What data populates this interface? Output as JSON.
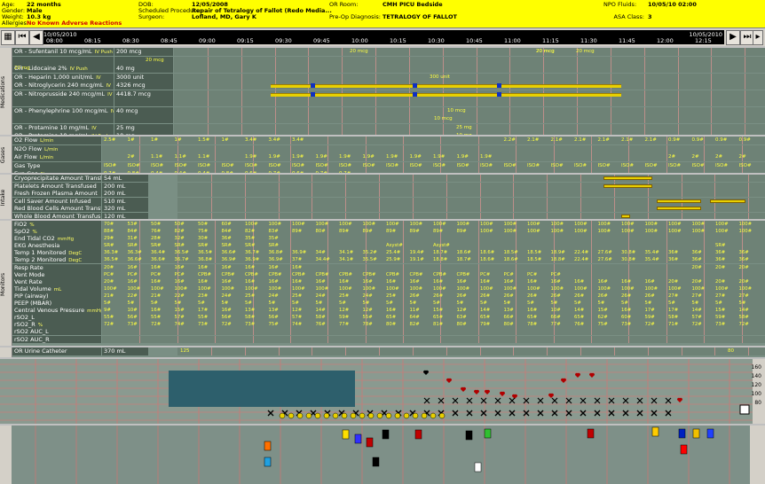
{
  "header": {
    "age_label": "Age:",
    "age": "22 months",
    "gender_label": "Gender:",
    "gender": "Male",
    "weight_label": "Weight:",
    "weight": "10.3 kg",
    "allergies_label": "Allergies:",
    "allergies": "No Known Adverse Reactions",
    "dob_label": "DOB:",
    "dob": "12/05/2008",
    "procedure_label": "Scheduled Procedure:",
    "procedure": "Repair of Tetralogy of Fallot  (Redo Media...",
    "surgeon_label": "Surgeon:",
    "surgeon": "Lofland, MD, Gary K",
    "or_room_label": "OR Room:",
    "or_room": "CMH PICU Bedside",
    "preop_label": "Pre-Op Diagnosis:",
    "preop": "TETRALOGY OF FALLOT",
    "npo_label": "NPO Fluids:",
    "npo": "10/05/10 02:00",
    "asa_label": "ASA Class:",
    "asa": "3"
  },
  "timeline": {
    "date_left": "10/05/2010",
    "date_right": "10/05/2010",
    "times": [
      "08:00",
      "08:15",
      "08:30",
      "08:45",
      "09:00",
      "09:15",
      "09:30",
      "09:45",
      "10:00",
      "10:15",
      "10:30",
      "10:45",
      "11:00",
      "11:15",
      "11:30",
      "11:45",
      "12:00",
      "12:15"
    ]
  },
  "sections": {
    "medications": {
      "title": "Medications",
      "rows": [
        {
          "label": "OR - Sufentanil 10 mcg/mL",
          "unit": "IV Push",
          "value": "200 mcg"
        },
        {
          "label": "",
          "unit": "",
          "value": ""
        },
        {
          "label": "OR - Lidocaine 2%",
          "unit": "IV Push",
          "value": "40 mg"
        },
        {
          "label": "OR - Heparin 1,000 unit/mL",
          "unit": "IV",
          "value": "3000 unit"
        },
        {
          "label": "OR - Nitroglycerin 240 mcg/mL",
          "unit": "IV",
          "value": "4326 mcg"
        },
        {
          "label": "OR - Nitroprusside 240 mcg/mL",
          "unit": "IV",
          "value": "4418.7 mcg"
        },
        {
          "label": "",
          "unit": "",
          "value": ""
        },
        {
          "label": "OR - Phenylephrine 100 mcg/mL",
          "unit": "IV",
          "value": "40 mcg"
        },
        {
          "label": "",
          "unit": "",
          "value": ""
        },
        {
          "label": "OR - Protamine 10 mg/mL",
          "unit": "IV",
          "value": "25 mg"
        },
        {
          "label": "OR - Protamine 10 mg/mL",
          "unit": "IV Push",
          "value": "10 mg"
        },
        {
          "label": "OR - Ephedrine 50 mg/mL",
          "unit": "IV",
          "value": "10 mg"
        },
        {
          "label": "OR - Amicar Bolus",
          "unit": "IV",
          "value": "1050 mg"
        }
      ],
      "doses": [
        {
          "row": 0,
          "text": "20 mcg"
        },
        {
          "row": 0,
          "text": "20 mcg"
        },
        {
          "row": 0,
          "text": "20 mcg"
        },
        {
          "row": 0,
          "text": "20 mcg"
        },
        {
          "row": 1,
          "text": "20 mcg"
        },
        {
          "row": 2,
          "text": "20 mg"
        },
        {
          "row": 3,
          "text": "300 unit"
        },
        {
          "row": 7,
          "text": "10 mcg"
        },
        {
          "row": 8,
          "text": "10 mcg"
        },
        {
          "row": 9,
          "text": "25 mg"
        },
        {
          "row": 10,
          "text": "10 mg"
        }
      ]
    },
    "gases": {
      "title": "Gases",
      "rows": [
        {
          "label": "O2 Flow",
          "unit": "L/min",
          "values": [
            "2.5#",
            "1#",
            "1#",
            "1#",
            "1.5#",
            "1#",
            "3.4#",
            "3.4#",
            "3.4#",
            "",
            "",
            "",
            "",
            "",
            "",
            "",
            "",
            "2.2#",
            "2.1#",
            "2.1#",
            "2.1#",
            "2.1#",
            "2.1#",
            "2.1#",
            "0.9#",
            "0.9#",
            "0.9#",
            "0.9#"
          ]
        },
        {
          "label": "N2O Flow",
          "unit": "L/min",
          "values": []
        },
        {
          "label": "Air Flow",
          "unit": "L/min",
          "values": [
            "",
            "2#",
            "1.1#",
            "1.1#",
            "1.1#",
            "",
            "1.9#",
            "1.9#",
            "1.9#",
            "1.9#",
            "1.9#",
            "1.9#",
            "1.9#",
            "1.9#",
            "1.9#",
            "1.9#",
            "1.9#",
            "",
            "",
            "",
            "",
            "",
            "",
            "",
            "2#",
            "2#",
            "2#",
            "2#"
          ]
        },
        {
          "label": "Gas Type",
          "unit": "",
          "values": [
            "ISO#",
            "ISO#",
            "ISO#",
            "ISO#",
            "ISO#",
            "ISO#",
            "ISO#",
            "ISO#",
            "ISO#",
            "ISO#",
            "ISO#",
            "ISO#",
            "ISO#",
            "ISO#",
            "ISO#",
            "ISO#",
            "ISO#",
            "ISO#",
            "ISO#",
            "ISO#",
            "ISO#",
            "ISO#",
            "ISO#",
            "ISO#",
            "ISO#",
            "ISO#",
            "ISO#",
            "ISO#"
          ]
        },
        {
          "label": "Exp Gas",
          "unit": "%",
          "values": [
            "0.7#",
            "0.8#",
            "0.4#",
            "0.4#",
            "0.4#",
            "0.8#",
            "0.6#",
            "0.7#",
            "0.6#",
            "0.7#",
            "0.7#"
          ]
        }
      ]
    },
    "intake": {
      "title": "Intake",
      "rows": [
        {
          "label": "Cryoprecipitate Amount Transf",
          "value": "54 mL"
        },
        {
          "label": "Platelets Amount Transfused",
          "value": "200 mL"
        },
        {
          "label": "Fresh Frozen Plasma Amount",
          "value": "200 mL"
        },
        {
          "label": "Cell Saver Amount Infused",
          "value": "510 mL"
        },
        {
          "label": "Red Blood Cells Amount Transf",
          "value": "320 mL"
        },
        {
          "label": "Whole Blood Amount Transfus",
          "value": "120 mL"
        }
      ]
    },
    "monitors": {
      "title": "Monitors",
      "rows": [
        {
          "label": "FiO2",
          "unit": "%",
          "values": [
            "70#",
            "53#",
            "50#",
            "50#",
            "50#",
            "60#",
            "100#",
            "100#",
            "100#",
            "100#",
            "100#",
            "100#",
            "100#",
            "100#",
            "100#",
            "100#",
            "100#",
            "100#",
            "100#",
            "100#",
            "100#",
            "100#",
            "100#",
            "100#",
            "100#",
            "100#",
            "100#",
            "100#"
          ]
        },
        {
          "label": "SpO2",
          "unit": "%",
          "values": [
            "88#",
            "84#",
            "76#",
            "82#",
            "75#",
            "84#",
            "82#",
            "83#",
            "89#",
            "80#",
            "89#",
            "89#",
            "89#",
            "89#",
            "89#",
            "89#",
            "100#",
            "100#",
            "100#",
            "100#",
            "100#",
            "100#",
            "100#",
            "100#",
            "100#",
            "100#",
            "100#",
            "100#"
          ]
        },
        {
          "label": "End Tidal CO2",
          "unit": "mmHg",
          "values": [
            "29#",
            "31#",
            "28#",
            "32#",
            "30#",
            "36#",
            "35#",
            "35#",
            "",
            "",
            "",
            "",
            "",
            "",
            "",
            "",
            "",
            "",
            "",
            "",
            "",
            "",
            "",
            "",
            "",
            "",
            "",
            ""
          ]
        },
        {
          "label": "EKG Anesthesia",
          "unit": "",
          "values": [
            "SR#",
            "SR#",
            "SR#",
            "SR#",
            "SR#",
            "SR#",
            "SR#",
            "SR#",
            "",
            "",
            "",
            "",
            "Asyst#",
            "",
            "Asyst#",
            "",
            "",
            "",
            "",
            "",
            "",
            "",
            "",
            "",
            "",
            "",
            "SR#",
            ""
          ]
        },
        {
          "label": "Temp 1 Monitored",
          "unit": "DegC",
          "values": [
            "36.3#",
            "36.3#",
            "36.4#",
            "36.5#",
            "36.5#",
            "36.6#",
            "36.7#",
            "36.8#",
            "36.9#",
            "34#",
            "34.1#",
            "35.2#",
            "25.4#",
            "19.4#",
            "18.7#",
            "18.6#",
            "18.6#",
            "18.5#",
            "18.5#",
            "18.9#",
            "22.4#",
            "27.6#",
            "30.8#",
            "35.4#",
            "36#",
            "36#",
            "36#",
            "36#"
          ]
        },
        {
          "label": "Temp 2 Monitored",
          "unit": "DegC",
          "values": [
            "36.5#",
            "36.6#",
            "36.6#",
            "36.7#",
            "36.8#",
            "36.9#",
            "36.9#",
            "36.9#",
            "37#",
            "34.4#",
            "34.1#",
            "35.5#",
            "25.9#",
            "19.1#",
            "18.8#",
            "18.7#",
            "18.6#",
            "18.6#",
            "18.5#",
            "18.8#",
            "22.4#",
            "27.6#",
            "30.8#",
            "35.4#",
            "36#",
            "36#",
            "36#",
            "36#"
          ]
        },
        {
          "label": "Resp Rate",
          "unit": "",
          "values": [
            "20#",
            "16#",
            "16#",
            "16#",
            "16#",
            "16#",
            "16#",
            "16#",
            "16#",
            "",
            "",
            "",
            "",
            "",
            "",
            "",
            "",
            "",
            "",
            "",
            "",
            "",
            "",
            "",
            "",
            "20#",
            "20#",
            "20#"
          ]
        },
        {
          "label": "Vent Mode",
          "unit": "",
          "values": [
            "PC#",
            "PC#",
            "PC#",
            "PC#",
            "CPB#",
            "CPB#",
            "CPB#",
            "CPB#",
            "CPB#",
            "CPB#",
            "CPB#",
            "CPB#",
            "CPB#",
            "CPB#",
            "CPB#",
            "CPB#",
            "PC#",
            "PC#",
            "PC#",
            "PC#"
          ]
        },
        {
          "label": "Vent Rate",
          "unit": "",
          "values": [
            "20#",
            "16#",
            "16#",
            "16#",
            "16#",
            "16#",
            "16#",
            "16#",
            "16#",
            "16#",
            "16#",
            "16#",
            "16#",
            "16#",
            "16#",
            "16#",
            "16#",
            "16#",
            "16#",
            "16#",
            "16#",
            "16#",
            "16#",
            "16#",
            "20#",
            "20#",
            "20#",
            "20#"
          ]
        },
        {
          "label": "Tidal Volume",
          "unit": "mL",
          "values": [
            "100#",
            "100#",
            "100#",
            "100#",
            "100#",
            "100#",
            "100#",
            "100#",
            "100#",
            "100#",
            "100#",
            "100#",
            "100#",
            "100#",
            "100#",
            "100#",
            "100#",
            "100#",
            "100#",
            "100#",
            "100#",
            "100#",
            "100#",
            "100#",
            "100#",
            "100#",
            "100#",
            "100#"
          ]
        },
        {
          "label": "PIP (airway)",
          "unit": "",
          "values": [
            "21#",
            "22#",
            "21#",
            "22#",
            "23#",
            "24#",
            "25#",
            "24#",
            "25#",
            "24#",
            "25#",
            "24#",
            "25#",
            "26#",
            "26#",
            "26#",
            "26#",
            "26#",
            "26#",
            "26#",
            "26#",
            "26#",
            "26#",
            "26#",
            "27#",
            "27#",
            "27#",
            "27#"
          ]
        },
        {
          "label": "PEEP (MBAR)",
          "unit": "",
          "values": [
            "5#",
            "5#",
            "5#",
            "5#",
            "5#",
            "5#",
            "5#",
            "5#",
            "5#",
            "5#",
            "5#",
            "5#",
            "5#",
            "5#",
            "5#",
            "5#",
            "5#",
            "5#",
            "5#",
            "5#",
            "5#",
            "5#",
            "5#",
            "5#",
            "5#",
            "5#",
            "5#",
            "5#"
          ]
        },
        {
          "label": "Central Venous Pressure",
          "unit": "mmHg",
          "values": [
            "9#",
            "10#",
            "16#",
            "15#",
            "17#",
            "16#",
            "13#",
            "13#",
            "12#",
            "14#",
            "12#",
            "12#",
            "16#",
            "11#",
            "15#",
            "12#",
            "14#",
            "13#",
            "16#",
            "10#",
            "14#",
            "15#",
            "16#",
            "17#",
            "17#",
            "14#",
            "15#",
            "14#"
          ]
        },
        {
          "label": "rSO2_L",
          "unit": "",
          "values": [
            "55#",
            "56#",
            "55#",
            "57#",
            "55#",
            "56#",
            "58#",
            "56#",
            "57#",
            "58#",
            "59#",
            "55#",
            "65#",
            "64#",
            "65#",
            "63#",
            "65#",
            "66#",
            "65#",
            "66#",
            "65#",
            "62#",
            "60#",
            "59#",
            "58#",
            "57#",
            "59#",
            "58#"
          ]
        },
        {
          "label": "rSO2_R",
          "unit": "%",
          "values": [
            "72#",
            "73#",
            "72#",
            "74#",
            "73#",
            "72#",
            "73#",
            "75#",
            "74#",
            "76#",
            "77#",
            "78#",
            "80#",
            "82#",
            "81#",
            "80#",
            "79#",
            "80#",
            "78#",
            "77#",
            "76#",
            "75#",
            "73#",
            "72#",
            "71#",
            "72#",
            "73#",
            "72#"
          ]
        },
        {
          "label": "rSO2 AUC_L",
          "unit": "",
          "values": []
        },
        {
          "label": "rSO2 AUC_R",
          "unit": "",
          "values": []
        }
      ]
    },
    "output": {
      "rows": [
        {
          "label": "OR Urine Catheter",
          "value": "370 mL",
          "marks": [
            "125",
            "80"
          ]
        }
      ]
    }
  },
  "hemo_scale": [
    "160",
    "140",
    "120",
    "100",
    "80"
  ],
  "icons": {
    "toolbar_left": "grid-icon",
    "prev": "arrow-left-icon",
    "next": "arrow-right-icon",
    "last": "arrow-end-icon"
  },
  "colors": {
    "header_bg": "#ffff00",
    "grid_bg": "#6e8276",
    "label_bg": "#4b5c52",
    "value_text": "#ffff40",
    "grid_line": "#ff8080",
    "hemo_bg": "#8a9a90",
    "cyan_block": "#2d5f6c"
  }
}
